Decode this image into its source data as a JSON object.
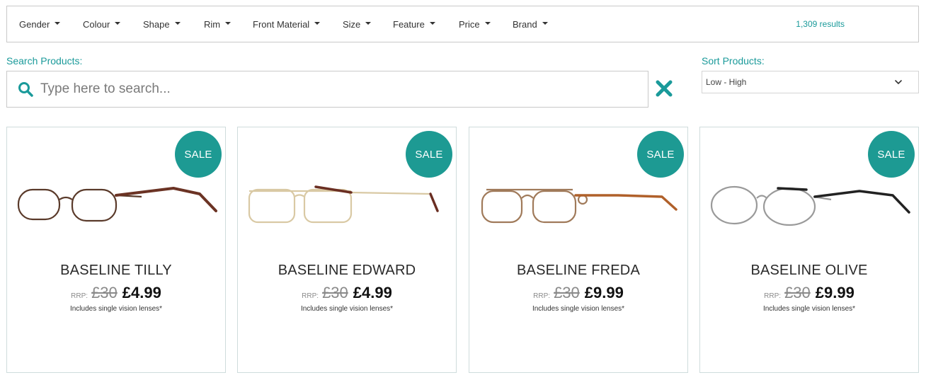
{
  "filters": [
    {
      "label": "Gender"
    },
    {
      "label": "Colour"
    },
    {
      "label": "Shape"
    },
    {
      "label": "Rim"
    },
    {
      "label": "Front Material"
    },
    {
      "label": "Size"
    },
    {
      "label": "Feature"
    },
    {
      "label": "Price"
    },
    {
      "label": "Brand"
    }
  ],
  "results_count": "1,309 results",
  "search": {
    "label": "Search Products:",
    "placeholder": "Type here to search...",
    "value": ""
  },
  "sort": {
    "label": "Sort Products:",
    "selected": "Low - High"
  },
  "colors": {
    "accent": "#1a9a9a",
    "sale_badge": "#1d9a93"
  },
  "products": [
    {
      "name": "BASELINE TILLY",
      "badge": "SALE",
      "rrp_label": "RRP:",
      "rrp": "£30",
      "price": "£4.99",
      "note": "Includes single vision lenses*",
      "frame_color": "#5a3a2a",
      "temple_color": "#6b3324"
    },
    {
      "name": "BASELINE EDWARD",
      "badge": "SALE",
      "rrp_label": "RRP:",
      "rrp": "£30",
      "price": "£4.99",
      "note": "Includes single vision lenses*",
      "frame_color": "#d9c9a4",
      "temple_color": "#6a2e22"
    },
    {
      "name": "BASELINE FREDA",
      "badge": "SALE",
      "rrp_label": "RRP:",
      "rrp": "£30",
      "price": "£9.99",
      "note": "Includes single vision lenses*",
      "frame_color": "#a07a5a",
      "temple_color": "#b0602a"
    },
    {
      "name": "BASELINE OLIVE",
      "badge": "SALE",
      "rrp_label": "RRP:",
      "rrp": "£30",
      "price": "£9.99",
      "note": "Includes single vision lenses*",
      "frame_color": "#9a9a9a",
      "temple_color": "#222222"
    }
  ]
}
